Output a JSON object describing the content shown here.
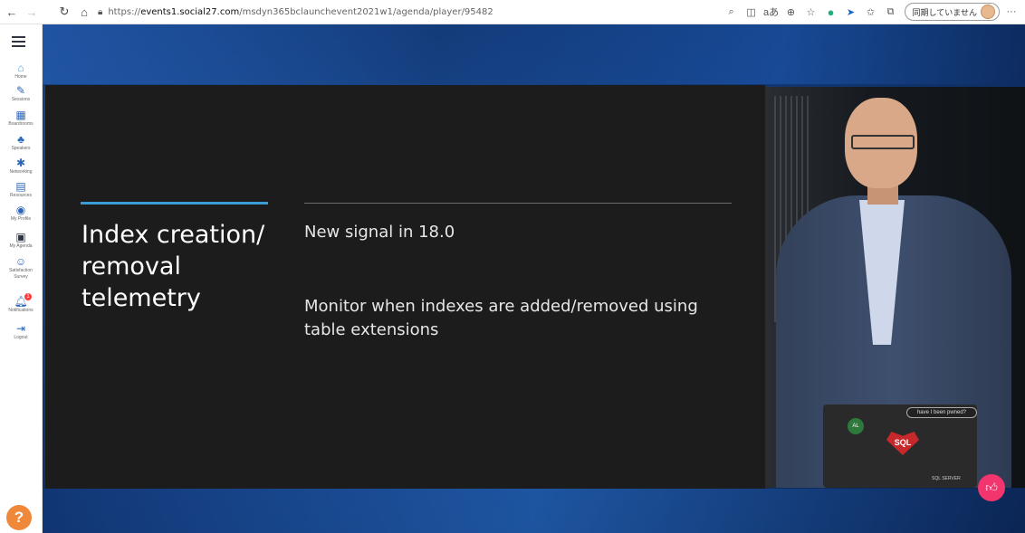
{
  "browser": {
    "url_host": "events1.social27.com",
    "url_path": "/msdyn365bclaunchevent2021w1/agenda/player/95482",
    "sync_label": "同期していません",
    "icons": [
      "back-icon",
      "forward-icon",
      "refresh-icon",
      "home-icon",
      "search-icon",
      "split-icon",
      "read-aloud-icon",
      "zoom-icon",
      "favorite-add-icon",
      "extension-green-icon",
      "extension-blue-icon",
      "favorites-icon",
      "collections-icon",
      "more-icon"
    ]
  },
  "sidebar": {
    "items": [
      {
        "label": "Home",
        "icon": "home-icon"
      },
      {
        "label": "Sessions",
        "icon": "pencil-icon"
      },
      {
        "label": "Boardrooms",
        "icon": "boardroom-icon"
      },
      {
        "label": "Speakers",
        "icon": "speaker-icon"
      },
      {
        "label": "Networking",
        "icon": "network-icon"
      },
      {
        "label": "Resources",
        "icon": "resources-icon"
      },
      {
        "label": "My Profile",
        "icon": "profile-icon"
      },
      {
        "label": "My Agenda",
        "icon": "calendar-icon"
      },
      {
        "label": "Satisfaction Survey",
        "icon": "survey-icon"
      },
      {
        "label": "Notifications",
        "icon": "bell-icon",
        "badge": "1"
      },
      {
        "label": "Logout",
        "icon": "logout-icon"
      }
    ],
    "help_label": "?"
  },
  "slide": {
    "title": "Index creation/ removal telemetry",
    "subtitle": "New signal in 18.0",
    "body": "Monitor when indexes are added/removed using table extensions"
  },
  "video": {
    "sticker_sql": "SQL",
    "sticker_al": "AL",
    "sticker_pwned": "have I been pwned?",
    "sticker_sqlserver": "SQL SERVER"
  },
  "colors": {
    "accent": "#3a9bd5",
    "slide_bg": "#1c1c1c",
    "rate_button": "#f2356d",
    "help_button": "#f0883a"
  }
}
